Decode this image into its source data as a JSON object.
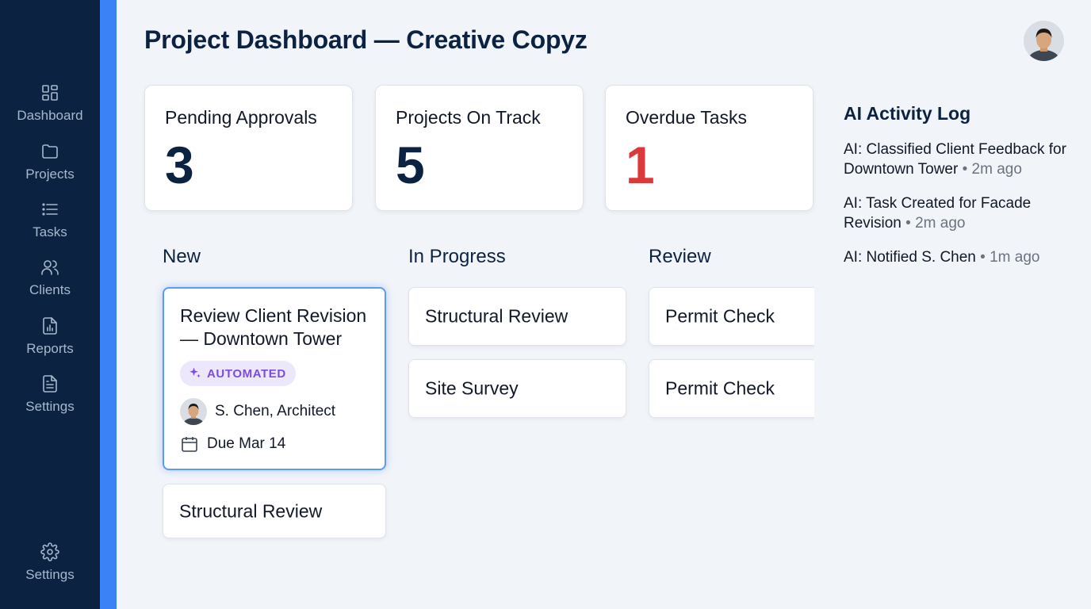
{
  "sidebar": {
    "items": [
      {
        "label": "Dashboard",
        "icon": "dashboard-grid-icon"
      },
      {
        "label": "Projects",
        "icon": "folder-icon"
      },
      {
        "label": "Tasks",
        "icon": "list-icon"
      },
      {
        "label": "Clients",
        "icon": "users-icon"
      },
      {
        "label": "Reports",
        "icon": "report-chart-icon"
      },
      {
        "label": "Settings",
        "icon": "document-icon"
      }
    ],
    "bottom": {
      "label": "Settings",
      "icon": "gear-icon"
    }
  },
  "header": {
    "title": "Project Dashboard — Creative Copyz"
  },
  "stats": [
    {
      "label": "Pending Approvals",
      "value": "3"
    },
    {
      "label": "Projects On Track",
      "value": "5"
    },
    {
      "label": "Overdue Tasks",
      "value": "1"
    }
  ],
  "activity_log": {
    "title": "AI Activity Log",
    "items": [
      {
        "text": "AI: Classified Client Feedback for Downtown Tower",
        "time": "• 2m ago"
      },
      {
        "text": "AI: Task Created for Facade Revision",
        "time": "• 2m ago"
      },
      {
        "text": "AI: Notified S. Chen",
        "time": "• 1m ago"
      }
    ]
  },
  "board": {
    "columns": [
      {
        "title": "New",
        "featured": {
          "title": "Review Client Revision — Downtown Tower",
          "badge": "AUTOMATED",
          "assignee": "S. Chen, Architect",
          "due": "Due Mar 14"
        },
        "cards": [
          "Structural Review"
        ]
      },
      {
        "title": "In Progress",
        "cards": [
          "Structural Review",
          "Site Survey"
        ]
      },
      {
        "title": "Review",
        "cards": [
          "Permit Check",
          "Permit Check"
        ]
      }
    ]
  },
  "colors": {
    "sidebar_bg": "#0b2340",
    "accent": "#3b82f6",
    "overdue": "#dc3a3a",
    "badge_purple": "#7c4ddb"
  }
}
